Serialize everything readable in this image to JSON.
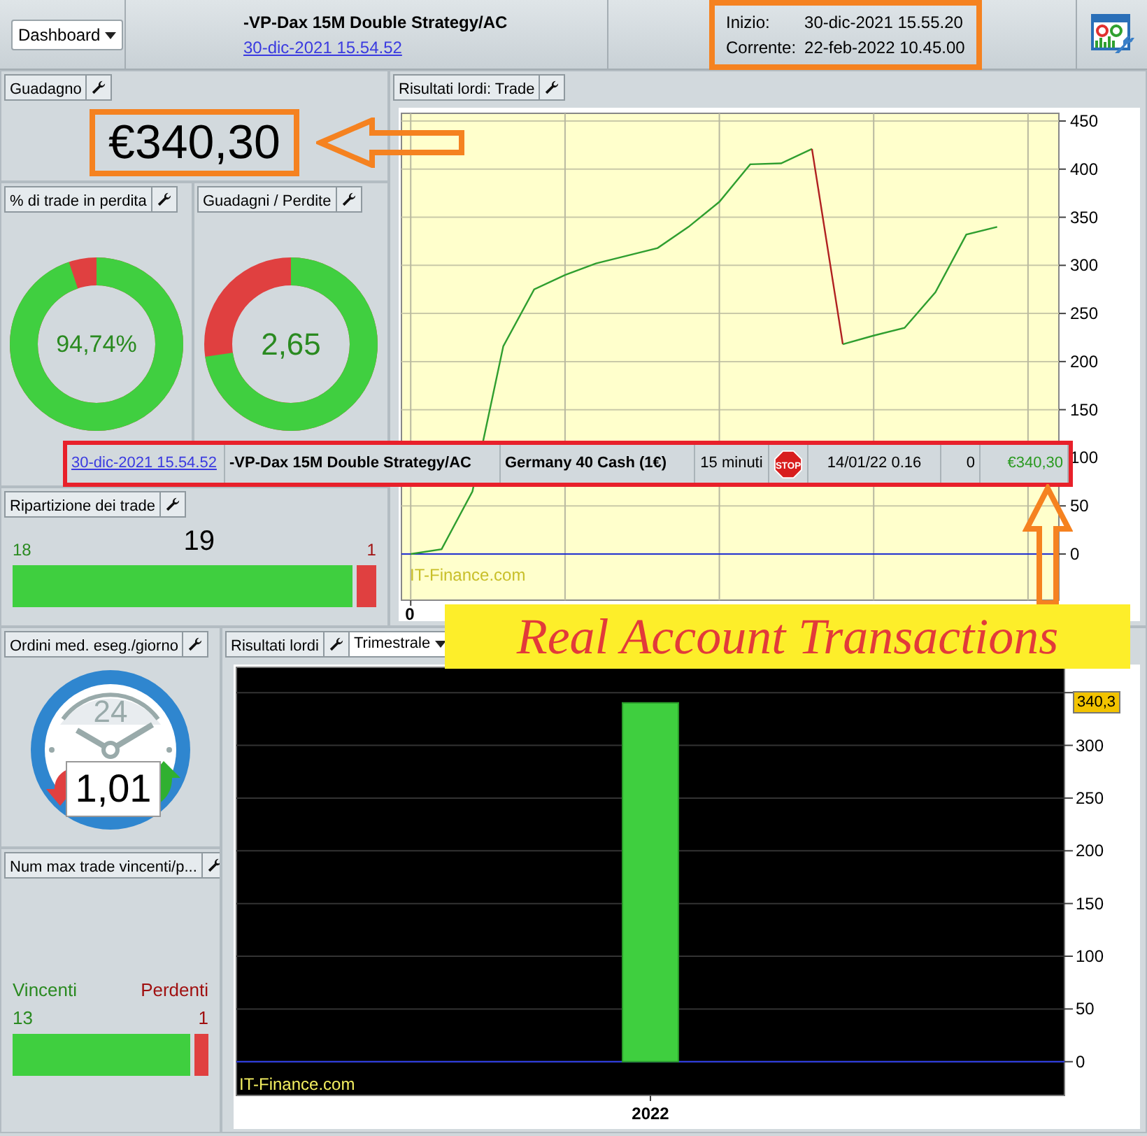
{
  "toolbar": {
    "dashboard_button": "Dashboard",
    "strategy_title": "-VP-Dax 15M Double Strategy/AC",
    "strategy_date": "30-dic-2021 15.54.52",
    "times": [
      {
        "label": "Inizio:",
        "value": "30-dic-2021 15.55.20"
      },
      {
        "label": "Corrente:",
        "value": "22-feb-2022 10.45.00"
      }
    ]
  },
  "gain_panel": {
    "title": "Guadagno",
    "value": "€340,30"
  },
  "loss_share_panel": {
    "title": "% di trade in perdita",
    "value": "94,74%",
    "level": 0.9474
  },
  "win_loss_panel": {
    "title": "Guadagni / Perdite",
    "value": "2,65",
    "level": 0.726
  },
  "trade_split_panel": {
    "title": "Ripartizione dei trade",
    "total": "19",
    "wins": "18",
    "losses": "1",
    "level": 0.947
  },
  "trade_chart_panel": {
    "title": "Risultati lordi: Trade",
    "watermark": "IT-Finance.com",
    "chart_data": {
      "type": "line",
      "grid": true,
      "ylim": [
        -48,
        458
      ],
      "yticks": [
        0,
        50,
        100,
        150,
        200,
        250,
        300,
        350,
        400,
        450
      ],
      "annotations": [
        "0"
      ],
      "ref_lines": [
        {
          "axis": "y",
          "value": 0,
          "color": "#2030d0"
        }
      ],
      "series": [
        {
          "color": "#2f9e2f",
          "values": [
            0,
            5,
            65,
            216,
            275,
            290,
            302,
            310,
            318,
            340,
            366,
            405,
            406,
            421,
            null,
            null,
            null,
            null,
            null,
            null
          ]
        },
        {
          "color": "#b02020",
          "values": [
            null,
            null,
            null,
            null,
            null,
            null,
            null,
            null,
            null,
            null,
            null,
            null,
            null,
            421,
            218,
            null,
            null,
            null,
            null,
            null
          ]
        },
        {
          "color": "#2f9e2f",
          "values": [
            null,
            null,
            null,
            null,
            null,
            null,
            null,
            null,
            null,
            null,
            null,
            null,
            null,
            null,
            218,
            227,
            235,
            272,
            332,
            340
          ]
        }
      ]
    }
  },
  "trade_row": {
    "cells": [
      {
        "kind": "link",
        "text": "30-dic-2021 15.54.52"
      },
      {
        "kind": "bold",
        "text": "-VP-Dax 15M Double Strategy/AC"
      },
      {
        "kind": "bold",
        "text": "Germany 40 Cash (1€)"
      },
      {
        "kind": "text",
        "text": "15 minuti"
      },
      {
        "kind": "stop",
        "text": "STOP"
      },
      {
        "kind": "text",
        "text": "14/01/22 0.16"
      },
      {
        "kind": "number",
        "text": "0"
      },
      {
        "kind": "money",
        "text": "€340,30"
      }
    ]
  },
  "orders_panel": {
    "title": "Ordini med. eseg./giorno",
    "dial_label": "24",
    "value": "1,01"
  },
  "streak_panel": {
    "title": "Num max trade vincenti/p...",
    "wins_label": "Vincenti",
    "losses_label": "Perdenti",
    "wins": "13",
    "losses": "1",
    "level": 0.93
  },
  "period_chart_panel": {
    "title": "Risultati lordi",
    "period_select": "Trimestrale",
    "watermark": "IT-Finance.com",
    "chart_data": {
      "type": "bar",
      "grid": true,
      "categories": [
        "2022"
      ],
      "values": [
        340.3
      ],
      "ylim": [
        -32,
        374
      ],
      "yticks": [
        0,
        50,
        100,
        150,
        200,
        250,
        300
      ],
      "ref_lines": [
        {
          "axis": "y",
          "value": 0,
          "color": "#3040f0"
        }
      ],
      "annotations": [
        "340,3"
      ]
    }
  },
  "annotation": {
    "banner": "Real Account Transactions"
  }
}
